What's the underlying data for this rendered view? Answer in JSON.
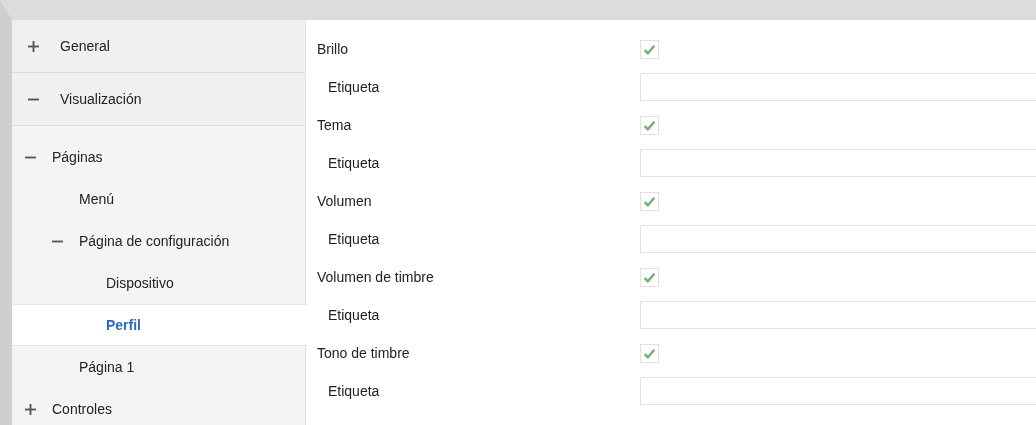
{
  "sidebar": {
    "sections": [
      {
        "label": "General",
        "expanded": false
      },
      {
        "label": "Visualización",
        "expanded": true,
        "children": [
          {
            "label": "Páginas",
            "expanded": true,
            "selected": false,
            "children": [
              {
                "label": "Menú",
                "selected": false
              },
              {
                "label": "Página de configuración",
                "expanded": true,
                "selected": false,
                "children": [
                  {
                    "label": "Dispositivo",
                    "selected": false
                  },
                  {
                    "label": "Perfil",
                    "selected": true
                  }
                ]
              },
              {
                "label": "Página 1",
                "selected": false
              }
            ]
          },
          {
            "label": "Controles",
            "expanded": false,
            "selected": false
          }
        ]
      }
    ]
  },
  "settings": [
    {
      "kind": "checkbox",
      "label": "Brillo",
      "checked": true
    },
    {
      "kind": "text",
      "label": "Etiqueta"
    },
    {
      "kind": "checkbox",
      "label": "Tema",
      "checked": true
    },
    {
      "kind": "text",
      "label": "Etiqueta"
    },
    {
      "kind": "checkbox",
      "label": "Volumen",
      "checked": true
    },
    {
      "kind": "text",
      "label": "Etiqueta"
    },
    {
      "kind": "checkbox",
      "label": "Volumen de timbre",
      "checked": true
    },
    {
      "kind": "text",
      "label": "Etiqueta"
    },
    {
      "kind": "checkbox",
      "label": "Tono de timbre",
      "checked": true
    },
    {
      "kind": "text",
      "label": "Etiqueta"
    }
  ]
}
